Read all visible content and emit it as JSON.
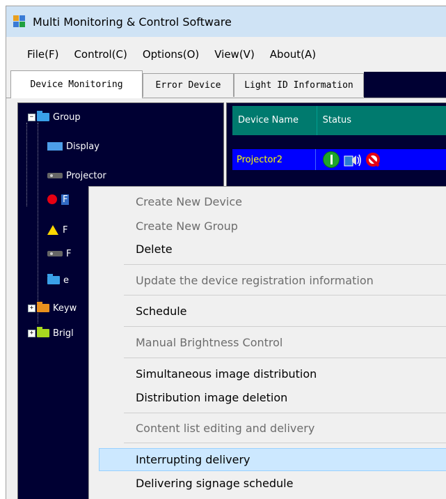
{
  "window": {
    "title": "Multi Monitoring & Control Software"
  },
  "menu": [
    "File(F)",
    "Control(C)",
    "Options(O)",
    "View(V)",
    "About(A)"
  ],
  "tabs": [
    "Device Monitoring",
    "Error Device",
    "Light ID Information"
  ],
  "tree": {
    "group": "Group",
    "display": "Display",
    "projector": "Projector",
    "truncated_nodes": [
      "F",
      "F",
      "F",
      "e"
    ],
    "keyword_partial": "Keyw",
    "brightness_partial": "Brigl"
  },
  "grid": {
    "columns": [
      "Device Name",
      "Status"
    ],
    "rows": [
      {
        "name": "Projector2",
        "status_icons": [
          "power-on-icon",
          "av-mute-icon",
          "stop-icon"
        ]
      }
    ]
  },
  "context_menu": {
    "items": [
      {
        "label": "Create New Device",
        "enabled": false
      },
      {
        "label": "Create New Group",
        "enabled": false
      },
      {
        "label": "Delete",
        "enabled": true
      },
      {
        "label": "Update the device registration information",
        "enabled": false
      },
      {
        "label": "Schedule",
        "enabled": true
      },
      {
        "label": "Manual Brightness Control",
        "enabled": false
      },
      {
        "label": "Simultaneous image distribution",
        "enabled": true
      },
      {
        "label": "Distribution image deletion",
        "enabled": true
      },
      {
        "label": "Content list editing and delivery",
        "enabled": false
      },
      {
        "label": "Interrupting delivery",
        "enabled": true,
        "highlighted": true
      },
      {
        "label": "Delivering signage schedule",
        "enabled": true
      }
    ]
  },
  "colors": {
    "tree_bg": "#000033",
    "grid_header": "#007a6e",
    "selected_row": "#0000ff",
    "device_name_text": "#ffff00",
    "menu_highlight": "#cce8ff"
  }
}
